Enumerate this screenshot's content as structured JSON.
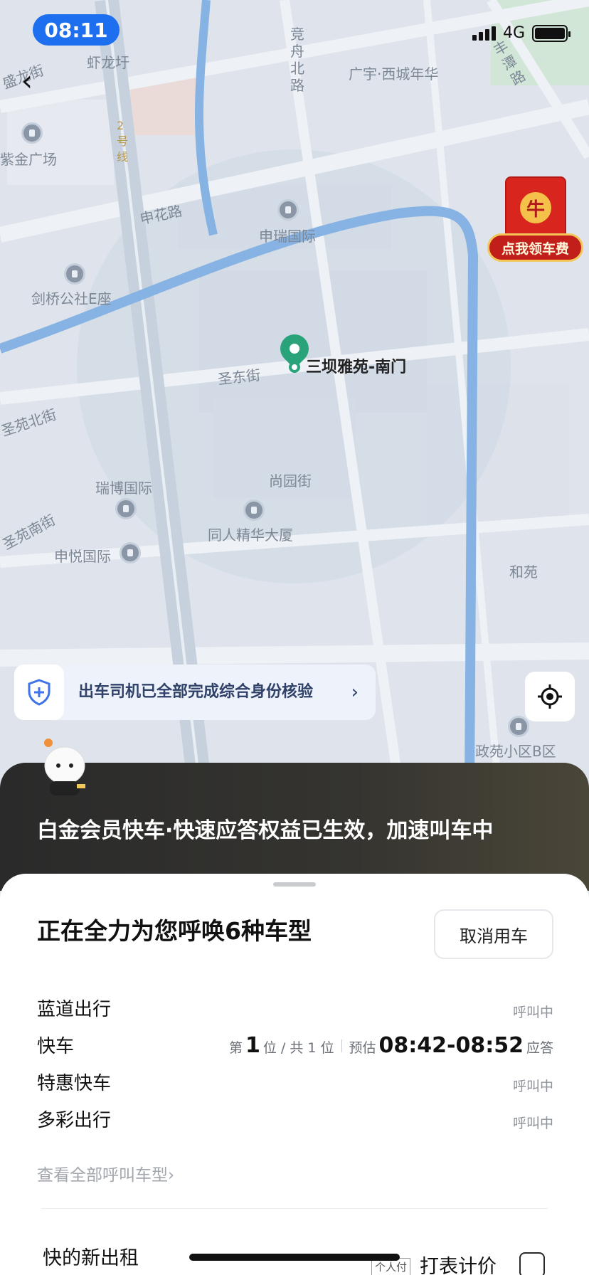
{
  "status_bar": {
    "time": "08:11",
    "network": "4G"
  },
  "map": {
    "labels": [
      "虾龙圩",
      "盛龙街",
      "竞舟北路",
      "广宇·西城年华",
      "丰潭路",
      "紫金广场",
      "2号线",
      "申花路",
      "申瑞国际",
      "剑桥公社E座",
      "圣东街",
      "圣苑北街",
      "瑞博国际",
      "尚园街",
      "同人精华大厦",
      "圣苑南街",
      "申悦国际",
      "和苑",
      "政苑小区B区"
    ],
    "destination": "三坝雅苑-南门",
    "promo_badge": {
      "icon": "牛",
      "text": "点我领车费"
    }
  },
  "verify_banner": {
    "text": "出车司机已全部完成综合身份核验",
    "arrow": "›"
  },
  "promo_banner": {
    "text": "白金会员快车·快速应答权益已生效，加速叫车中"
  },
  "sheet": {
    "title": "正在全力为您呼唤6种车型",
    "cancel_label": "取消用车",
    "rows": [
      {
        "name": "蓝道出行",
        "status": "呼叫中"
      },
      {
        "name": "快车",
        "queue_prefix": "第",
        "queue_pos": "1",
        "queue_suffix": "位 / 共 1 位",
        "eta_prefix": "预估",
        "eta": "08:42-08:52",
        "eta_suffix": "应答"
      },
      {
        "name": "特惠快车",
        "status": "呼叫中"
      },
      {
        "name": "多彩出行",
        "status": "呼叫中"
      }
    ],
    "all_types_link": "查看全部呼叫车型",
    "taxi": {
      "name": "快的新出租",
      "pay_tag": "个人付",
      "meter_label": "打表计价"
    }
  },
  "colors": {
    "accent": "#1e6ef0",
    "pin": "#2aa37a",
    "promo_red": "#d8261f"
  }
}
